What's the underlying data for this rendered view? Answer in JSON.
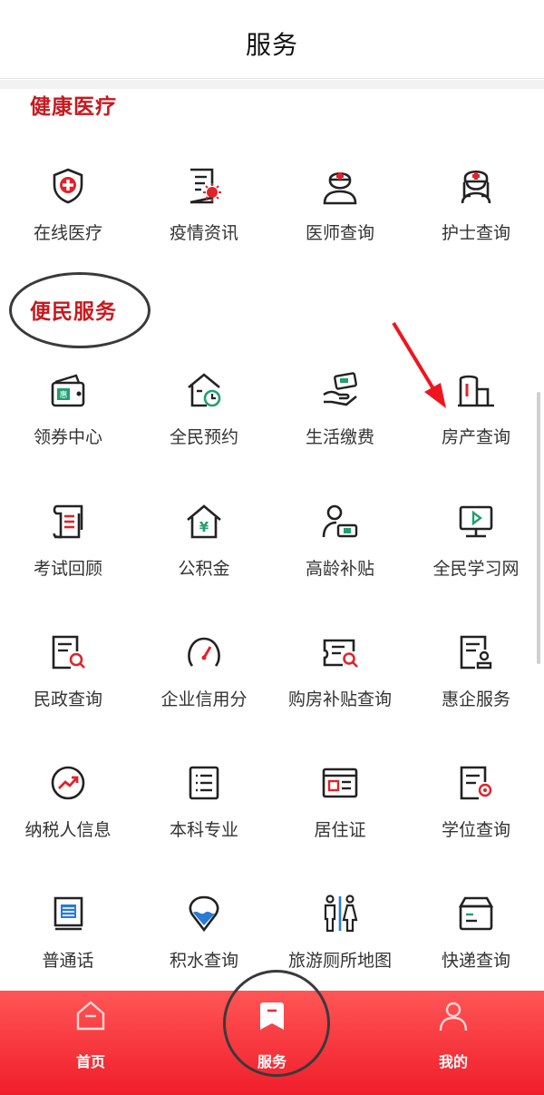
{
  "header": {
    "title": "服务"
  },
  "sections": {
    "health": {
      "title": "健康医疗"
    },
    "civic": {
      "title": "便民服务"
    }
  },
  "health_items": [
    {
      "label": "在线医疗",
      "icon": "medical-shield-icon"
    },
    {
      "label": "疫情资讯",
      "icon": "epidemic-news-icon"
    },
    {
      "label": "医师查询",
      "icon": "doctor-icon"
    },
    {
      "label": "护士查询",
      "icon": "nurse-icon"
    }
  ],
  "civic_items": [
    {
      "label": "领券中心",
      "icon": "coupon-wallet-icon"
    },
    {
      "label": "全民预约",
      "icon": "house-clock-icon"
    },
    {
      "label": "生活缴费",
      "icon": "payment-hand-icon"
    },
    {
      "label": "房产查询",
      "icon": "building-icon"
    },
    {
      "label": "考试回顾",
      "icon": "scroll-icon"
    },
    {
      "label": "公积金",
      "icon": "house-yen-icon"
    },
    {
      "label": "高龄补贴",
      "icon": "elder-ticket-icon"
    },
    {
      "label": "全民学习网",
      "icon": "monitor-play-icon"
    },
    {
      "label": "民政查询",
      "icon": "document-search-icon"
    },
    {
      "label": "企业信用分",
      "icon": "gauge-icon"
    },
    {
      "label": "购房补贴查询",
      "icon": "ticket-search-icon"
    },
    {
      "label": "惠企服务",
      "icon": "document-stamp-icon"
    },
    {
      "label": "纳税人信息",
      "icon": "trend-circle-icon"
    },
    {
      "label": "本科专业",
      "icon": "list-document-icon"
    },
    {
      "label": "居住证",
      "icon": "id-card-icon"
    },
    {
      "label": "学位查询",
      "icon": "document-badge-icon"
    },
    {
      "label": "普通话",
      "icon": "book-icon"
    },
    {
      "label": "积水查询",
      "icon": "water-pin-icon"
    },
    {
      "label": "旅游厕所地图",
      "icon": "toilet-icon"
    },
    {
      "label": "快递查询",
      "icon": "package-icon"
    }
  ],
  "bottom_nav": [
    {
      "label": "首页",
      "icon": "home-icon"
    },
    {
      "label": "服务",
      "icon": "bookmark-icon"
    },
    {
      "label": "我的",
      "icon": "user-icon"
    }
  ],
  "colors": {
    "accent": "#c8191e",
    "nav": "#f01d2a"
  }
}
